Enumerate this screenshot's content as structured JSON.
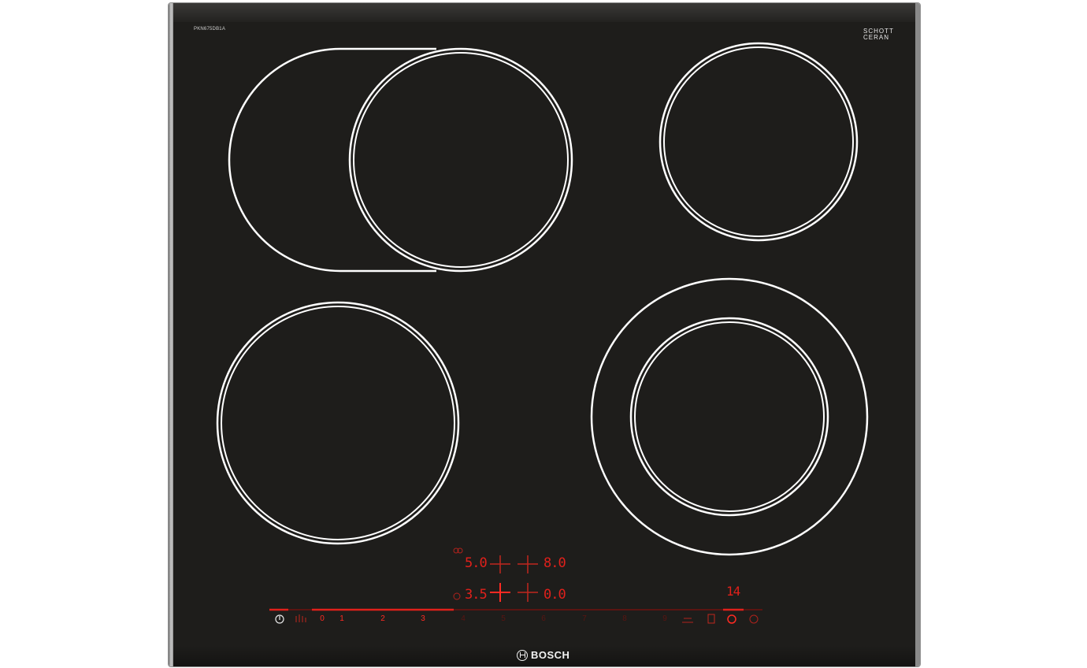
{
  "product": {
    "model_label": "PKN675DB1A",
    "glass_brand_line1": "SCHOTT",
    "glass_brand_line2": "CERAN",
    "brand": "BOSCH"
  },
  "displays": {
    "top_left": "5.0",
    "top_right": "8.0",
    "bottom_left": "3.5",
    "bottom_right": "0.0",
    "timer": "14"
  },
  "power_scale": [
    "0",
    "1",
    "2",
    "3",
    "4",
    "5",
    "6",
    "7",
    "8",
    "9"
  ],
  "colors": {
    "glass": "#1e1d1b",
    "ring": "#ffffff",
    "indicator_red": "#e0201b"
  }
}
